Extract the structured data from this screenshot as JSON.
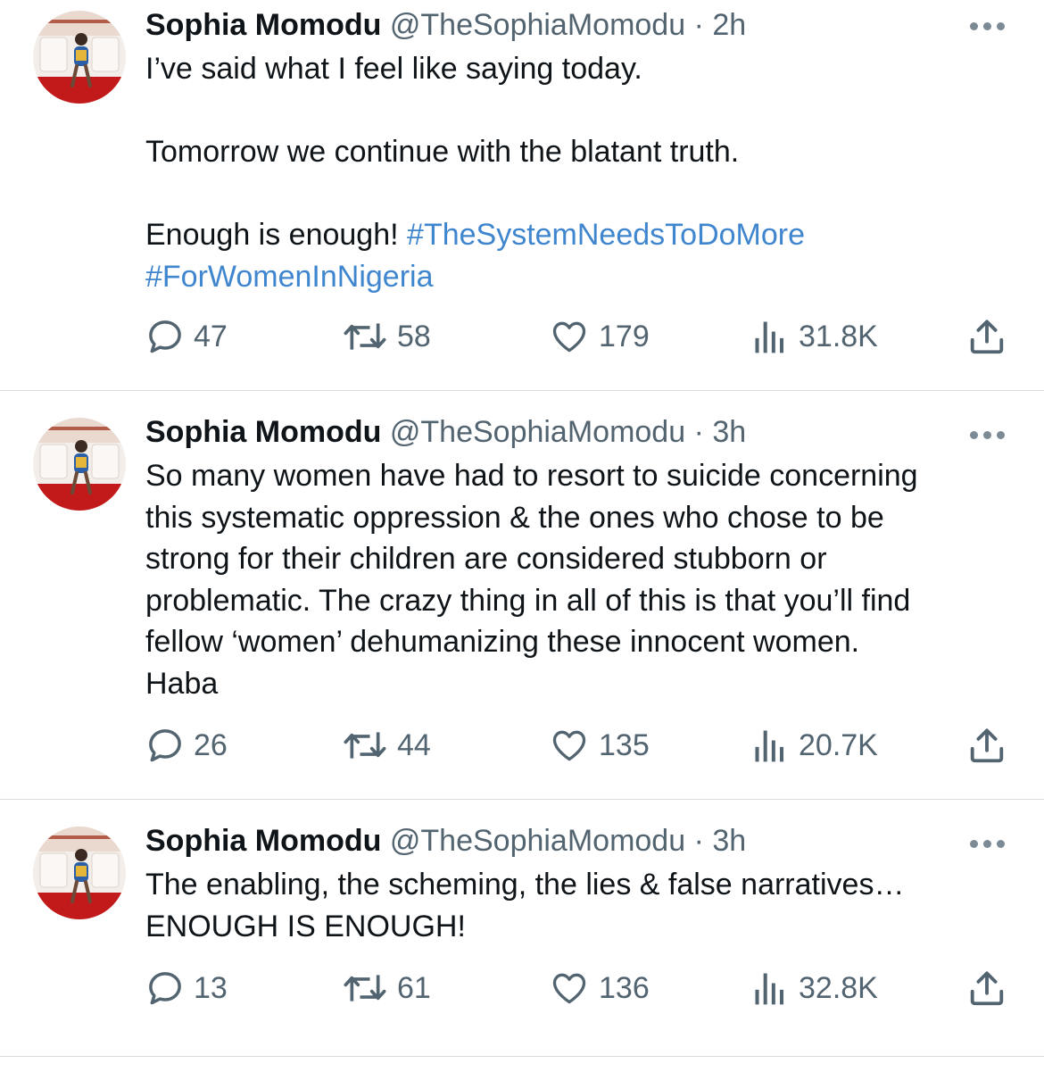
{
  "tweets": [
    {
      "name": "Sophia Momodu",
      "handle": "@TheSophiaMomodu",
      "time": "2h",
      "lines": [
        "I’ve said what I feel like saying today.",
        "",
        "Tomorrow we continue with the blatant truth.",
        "",
        "Enough is enough! ",
        "#ForWomenInNigeria"
      ],
      "hashtag_inline": "#TheSystemNeedsToDoMore",
      "stats": {
        "replies": "47",
        "retweets": "58",
        "likes": "179",
        "views": "31.8K"
      }
    },
    {
      "name": "Sophia Momodu",
      "handle": "@TheSophiaMomodu",
      "time": "3h",
      "lines": [
        "So many women have had to resort to suicide concerning",
        "this systematic oppression & the ones who chose to be",
        "strong for their children are considered stubborn or",
        "problematic. The crazy thing in all of this is that you’ll find",
        "fellow ‘women’ dehumanizing these innocent women.",
        "Haba"
      ],
      "stats": {
        "replies": "26",
        "retweets": "44",
        "likes": "135",
        "views": "20.7K"
      }
    },
    {
      "name": "Sophia Momodu",
      "handle": "@TheSophiaMomodu",
      "time": "3h",
      "lines": [
        "The enabling, the scheming, the lies & false narratives…",
        "ENOUGH IS ENOUGH!"
      ],
      "stats": {
        "replies": "13",
        "retweets": "61",
        "likes": "136",
        "views": "32.8K"
      }
    }
  ],
  "separator": " · ",
  "icons": [
    "avatar-photo",
    "more-icon",
    "reply-icon",
    "retweet-icon",
    "like-icon",
    "views-icon",
    "share-icon"
  ],
  "colors": {
    "text": "#0f1419",
    "muted": "#536471",
    "hashtag": "#3f86cf",
    "divider": "#d8dde1"
  }
}
